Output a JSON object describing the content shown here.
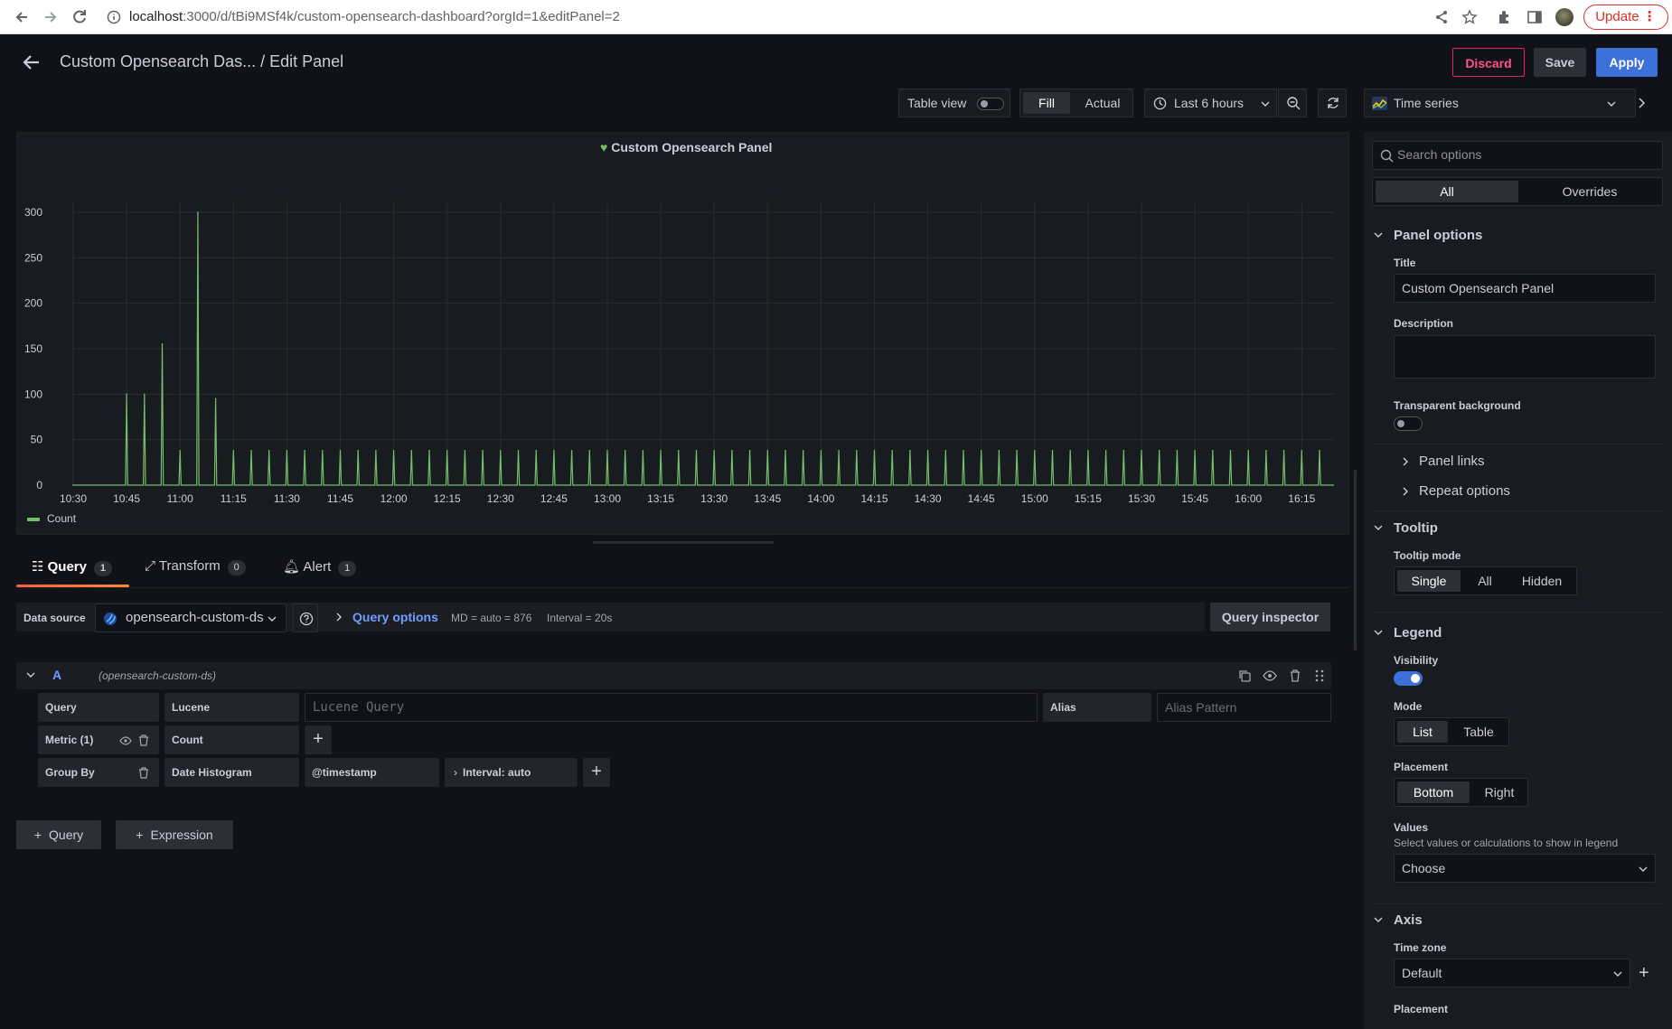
{
  "browser": {
    "url_host": "localhost",
    "url_path": ":3000/d/tBi9MSf4k/custom-opensearch-dashboard?orgId=1&editPanel=2",
    "update_label": "Update"
  },
  "header": {
    "title": "Custom Opensearch Das... / Edit Panel",
    "discard_label": "Discard",
    "save_label": "Save",
    "apply_label": "Apply"
  },
  "toolbar": {
    "table_view_label": "Table view",
    "fill_label": "Fill",
    "actual_label": "Actual",
    "time_range": "Last 6 hours",
    "visualization": "Time series"
  },
  "panel": {
    "title": "Custom Opensearch Panel",
    "legend_label": "Count"
  },
  "chart_data": {
    "type": "line",
    "title": "Custom Opensearch Panel",
    "xlabel": "",
    "ylabel": "",
    "ylim": [
      0,
      300
    ],
    "y_ticks": [
      "0",
      "50",
      "100",
      "150",
      "200",
      "250",
      "300"
    ],
    "x_ticks": [
      "10:30",
      "10:45",
      "11:00",
      "11:15",
      "11:30",
      "11:45",
      "12:00",
      "12:15",
      "12:30",
      "12:45",
      "13:00",
      "13:15",
      "13:30",
      "13:45",
      "14:00",
      "14:15",
      "14:30",
      "14:45",
      "15:00",
      "15:15",
      "15:30",
      "15:45",
      "16:00",
      "16:15"
    ],
    "grid": true,
    "legend_placement": "bottom",
    "series": [
      {
        "name": "Count",
        "color": "#73bf69",
        "spikes_minutes_after_1030": [
          15,
          20,
          25,
          30,
          35,
          40,
          45,
          50,
          55,
          60,
          65,
          70,
          75,
          80,
          85,
          90,
          95,
          100,
          105,
          110,
          115,
          120,
          125,
          130,
          135,
          140,
          145,
          150,
          155,
          160,
          165,
          170,
          175,
          180,
          185,
          190,
          195,
          200,
          205,
          210,
          215,
          220,
          225,
          230,
          235,
          240,
          245,
          250,
          255,
          260,
          265,
          270,
          275,
          280,
          285,
          290,
          295,
          300,
          305,
          310,
          315,
          320,
          325,
          330,
          335,
          340,
          345,
          350
        ],
        "spike_values": [
          100,
          100,
          155,
          38,
          300,
          95,
          38,
          38,
          38,
          38,
          38,
          38,
          38,
          38,
          38,
          38,
          38,
          38,
          38,
          38,
          38,
          38,
          38,
          38,
          38,
          38,
          38,
          38,
          38,
          38,
          38,
          38,
          38,
          38,
          38,
          38,
          38,
          38,
          38,
          38,
          38,
          38,
          38,
          38,
          38,
          38,
          38,
          38,
          38,
          38,
          38,
          38,
          38,
          38,
          38,
          38,
          38,
          38,
          38,
          38,
          38,
          38,
          38,
          38,
          38,
          38,
          38,
          38
        ]
      }
    ]
  },
  "tabs": [
    {
      "label": "Query",
      "count": "1"
    },
    {
      "label": "Transform",
      "count": "0"
    },
    {
      "label": "Alert",
      "count": "1"
    }
  ],
  "query": {
    "datasource_label": "Data source",
    "datasource_name": "opensearch-custom-ds",
    "options_label": "Query options",
    "md": "MD = auto = 876",
    "interval": "Interval = 20s",
    "inspector_label": "Query inspector",
    "ref_id": "A",
    "ref_ds": "(opensearch-custom-ds)",
    "query_label": "Query",
    "query_type": "Lucene",
    "query_placeholder": "Lucene Query",
    "alias_label": "Alias",
    "alias_placeholder": "Alias Pattern",
    "metric_label": "Metric (1)",
    "metric_value": "Count",
    "group_by_label": "Group By",
    "group_by_value": "Date Histogram",
    "group_by_field": "@timestamp",
    "group_by_interval": "Interval: auto",
    "add_query_label": "Query",
    "add_expression_label": "Expression"
  },
  "options": {
    "search_placeholder": "Search options",
    "all_label": "All",
    "overrides_label": "Overrides",
    "panel_options": "Panel options",
    "title_label": "Title",
    "title_value": "Custom Opensearch Panel",
    "description_label": "Description",
    "transparent_label": "Transparent background",
    "panel_links": "Panel links",
    "repeat_options": "Repeat options",
    "tooltip": "Tooltip",
    "tooltip_mode_label": "Tooltip mode",
    "tooltip_modes": [
      "Single",
      "All",
      "Hidden"
    ],
    "legend": "Legend",
    "visibility_label": "Visibility",
    "mode_label": "Mode",
    "modes": [
      "List",
      "Table"
    ],
    "placement_label": "Placement",
    "placements": [
      "Bottom",
      "Right"
    ],
    "values_label": "Values",
    "values_desc": "Select values or calculations to show in legend",
    "values_placeholder": "Choose",
    "axis": "Axis",
    "timezone_label": "Time zone",
    "timezone_value": "Default",
    "axis_placement_label": "Placement"
  }
}
